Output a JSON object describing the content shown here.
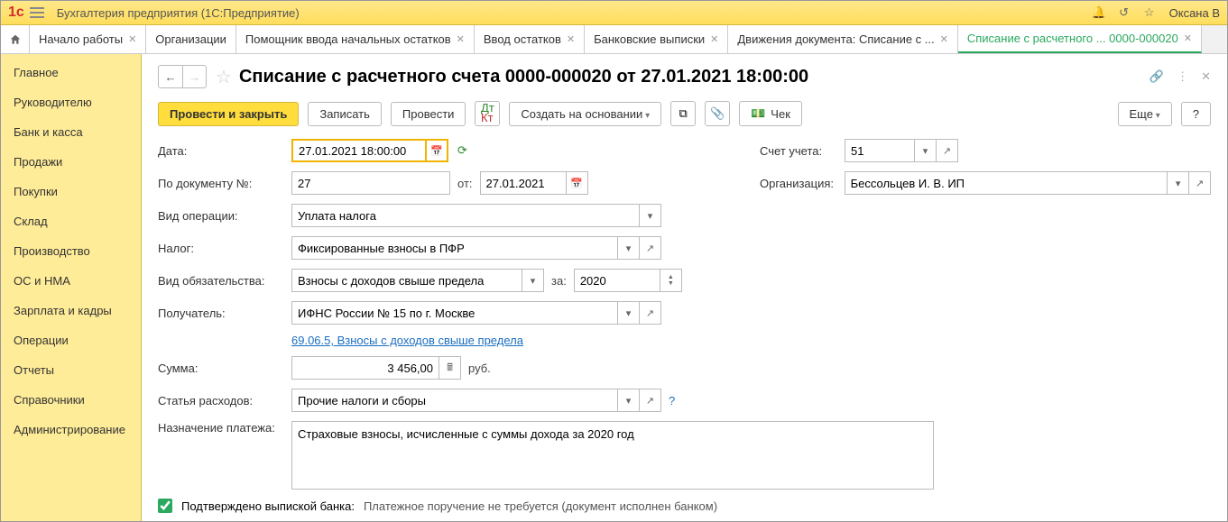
{
  "title": "Бухгалтерия предприятия  (1С:Предприятие)",
  "user": "Оксана В",
  "tabs": [
    "Начало работы",
    "Организации",
    "Помощник ввода начальных остатков",
    "Ввод остатков",
    "Банковские выписки",
    "Движения документа: Списание с ...",
    "Списание с расчетного ... 0000-000020"
  ],
  "sidebar": [
    "Главное",
    "Руководителю",
    "Банк и касса",
    "Продажи",
    "Покупки",
    "Склад",
    "Производство",
    "ОС и НМА",
    "Зарплата и кадры",
    "Операции",
    "Отчеты",
    "Справочники",
    "Администрирование"
  ],
  "pageTitle": "Списание с расчетного счета 0000-000020 от 27.01.2021 18:00:00",
  "btns": {
    "post_close": "Провести и закрыть",
    "write": "Записать",
    "post": "Провести",
    "create_on": "Создать на основании",
    "cheque": "Чек",
    "more": "Еще",
    "help": "?"
  },
  "labels": {
    "date": "Дата:",
    "docnum": "По документу №:",
    "ot": "от:",
    "account": "Счет учета:",
    "org": "Организация:",
    "optype": "Вид операции:",
    "tax": "Налог:",
    "obligation": "Вид обязательства:",
    "za": "за:",
    "recipient": "Получатель:",
    "sum": "Сумма:",
    "rub": "руб.",
    "expense": "Статья расходов:",
    "purpose": "Назначение платежа:",
    "confirmed": "Подтверждено выпиской банка:",
    "nopayment": "Платежное поручение не требуется (документ исполнен банком)"
  },
  "values": {
    "date": "27.01.2021 18:00:00",
    "docnum": "27",
    "docdate": "27.01.2021",
    "account": "51",
    "org": "Бессольцев И. В. ИП",
    "optype": "Уплата налога",
    "tax": "Фиксированные взносы в ПФР",
    "obligation": "Взносы с доходов свыше предела",
    "year": "2020",
    "recipient": "ИФНС России № 15 по г. Москве",
    "kbk": "69.06.5, Взносы с доходов свыше предела",
    "sum": "3 456,00",
    "expense": "Прочие налоги и сборы",
    "purpose": "Страховые взносы, исчисленные с суммы дохода за 2020 год"
  }
}
